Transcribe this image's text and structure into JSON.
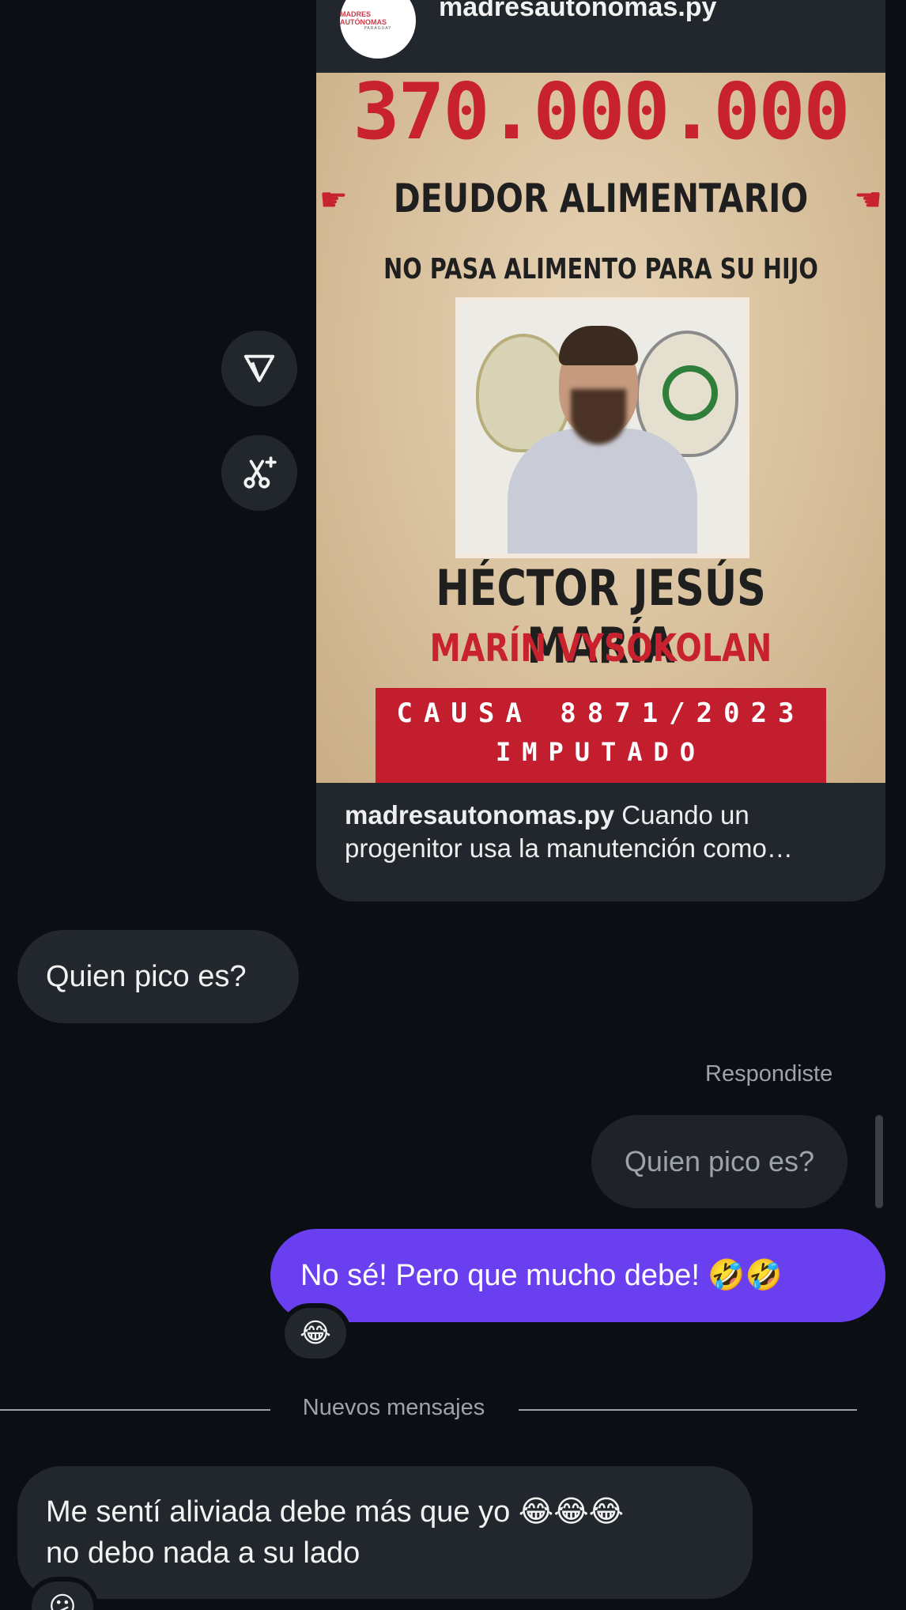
{
  "post": {
    "account": "madresautonomas.py",
    "avatar_logo_text": "MADRES AUTÓNOMAS",
    "avatar_logo_sub": "PARAGUAY",
    "poster": {
      "amount": "370.000.000",
      "title": "DEUDOR ALIMENTARIO",
      "subtitle": "NO PASA ALIMENTO PARA SU HIJO",
      "name": "HÉCTOR JESÚS MARÍA",
      "surname": "MARÍN VYSOKOLAN",
      "case_line": "CAUSA 8871/2023",
      "status": "IMPUTADO",
      "hand_left": "☛",
      "hand_right": "☚"
    },
    "caption_account": "madresautonomas.py",
    "caption_text": " Cuando un progenitor usa la manutención como…"
  },
  "actions": {
    "share_icon": "send-icon",
    "remix_icon": "scissors-sparkle-icon"
  },
  "messages": {
    "incoming_1": "Quien pico es?",
    "replied_label": "Respondiste",
    "replied_quote": "Quien pico es?",
    "outgoing_1": "No sé! Pero que mucho debe! 🤣🤣",
    "reaction_1": "😂",
    "new_messages_label": "Nuevos mensajes",
    "incoming_2_line1": "Me sentí aliviada debe más que yo 😂😂😂",
    "incoming_2_line2": "no debo nada a su lado",
    "reaction_2": "😕"
  }
}
